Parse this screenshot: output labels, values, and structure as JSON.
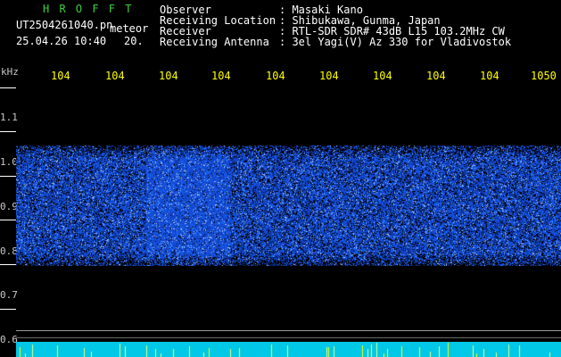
{
  "header": {
    "brand": "H R O F F T",
    "filename": "UT2504261040.pn",
    "tag": "meteor",
    "datetime": "25.04.26 10:40",
    "count": "20.",
    "fields": [
      {
        "label": "Observer",
        "value": ": Masaki Kano"
      },
      {
        "label": "Receiving Location",
        "value": ": Shibukawa, Gunma, Japan"
      },
      {
        "label": "Receiver",
        "value": ": RTL-SDR SDR# 43dB L15 103.2MHz CW"
      },
      {
        "label": "Receiving Antenna",
        "value": ": 3el Yagi(V) Az 330 for Vladivostok"
      }
    ]
  },
  "axis": {
    "unit": "kHz",
    "x_ticks": [
      "104",
      "104",
      "104",
      "104",
      "104",
      "104",
      "104",
      "104",
      "104",
      "1050"
    ],
    "y_ticks": [
      "1.1",
      "1.0",
      "0.9",
      "0.8",
      "0.7",
      "0.6"
    ]
  },
  "colors": {
    "noise": "#1e46ff",
    "band": "#00c8e6",
    "text_label": "#ffff00",
    "brand": "#3cd13c"
  }
}
